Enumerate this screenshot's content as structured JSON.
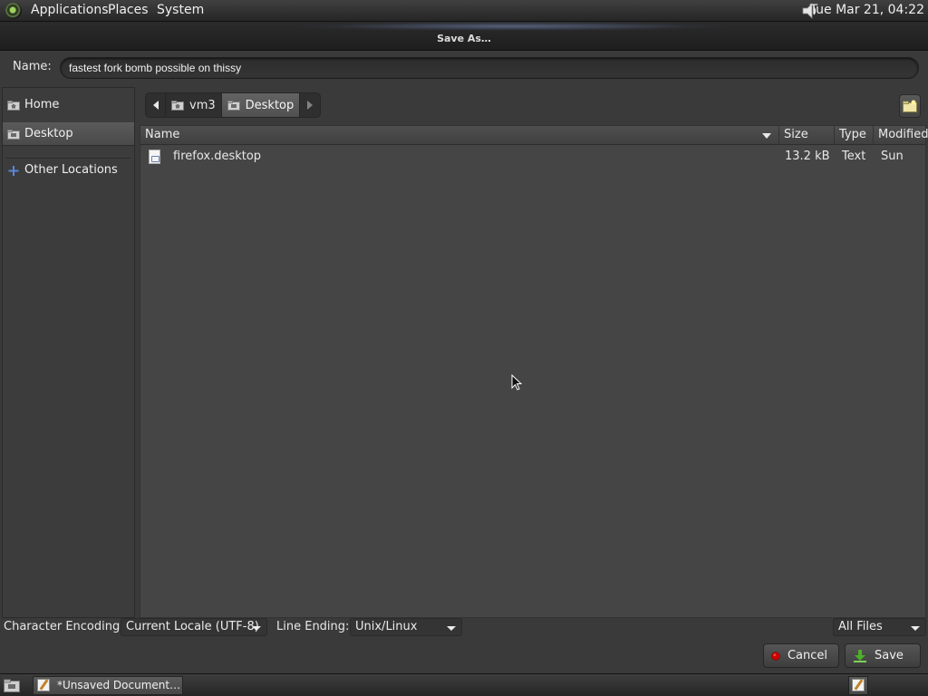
{
  "top_panel": {
    "menus": [
      "Applications",
      "Places",
      "System"
    ],
    "clock": "Tue Mar 21, 04:22"
  },
  "dialog": {
    "title": "Save As…",
    "name_label": "Name:",
    "name_value": "fastest fork bomb possible on thissy"
  },
  "sidebar": {
    "items": [
      {
        "label": "Home",
        "icon": "home-folder-icon"
      },
      {
        "label": "Desktop",
        "icon": "desktop-folder-icon"
      },
      {
        "label": "Other Locations",
        "icon": "plus-icon"
      }
    ]
  },
  "pathbar": {
    "crumbs": [
      "vm3",
      "Desktop"
    ]
  },
  "filelist": {
    "columns": [
      "Name",
      "Size",
      "Type",
      "Modified"
    ],
    "rows": [
      {
        "name": "firefox.desktop",
        "size": "13.2 kB",
        "type": "Text",
        "modified": "Sun"
      }
    ]
  },
  "options": {
    "encoding_label": "Character Encoding:",
    "encoding_value": "Current Locale (UTF-8)",
    "line_ending_label": "Line Ending:",
    "line_ending_value": "Unix/Linux",
    "filter_value": "All Files"
  },
  "buttons": {
    "cancel": "Cancel",
    "save": "Save"
  },
  "taskbar": {
    "task_label": "*Unsaved Document…"
  },
  "colors": {
    "accent_cancel": "#d40000",
    "accent_save": "#4caf2a"
  }
}
